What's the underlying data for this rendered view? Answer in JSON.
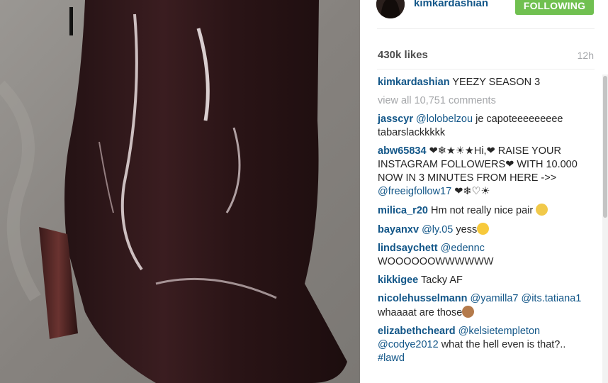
{
  "post": {
    "username": "kimkardashian",
    "follow_label": "FOLLOWING",
    "likes": "430k likes",
    "time": "12h"
  },
  "caption": {
    "user": "kimkardashian",
    "text": "YEEZY SEASON 3"
  },
  "view_all": "view all 10,751 comments",
  "comments": [
    {
      "user": "jasscyr",
      "mention": "@lolobelzou",
      "text": " je capoteeeeeeeee tabarslackkkkk"
    },
    {
      "user": "abw65834",
      "text": "❤❄★☀★Hi,❤ RAISE YOUR INSTAGRAM FOLLOWERS❤ WITH 10.000 NOW IN 3 MINUTES FROM HERE ->> ",
      "mention": "@freeigfollow17",
      "text2": " ❤❄♡☀"
    },
    {
      "user": "milica_r20",
      "text": "Hm not really nice pair "
    },
    {
      "user": "bayanxv",
      "mention": "@ly.05",
      "text": " yess"
    },
    {
      "user": "lindsaychett",
      "mention": "@edennc",
      "text": " WOOOOOOWWWWWW"
    },
    {
      "user": "kikkigee",
      "text": "Tacky AF"
    },
    {
      "user": "nicolehusselmann",
      "mention": "@yamilla7",
      "mention2": "@its.tatiana1",
      "text": " whaaaat are those"
    },
    {
      "user": "elizabethcheard",
      "mention": "@kelsietempleton",
      "mention2": "@codye2012",
      "text": " what the hell even is that?..",
      "hashtag": "#lawd"
    }
  ],
  "colors": {
    "username": "#125688",
    "follow_button": "#70c050",
    "muted": "#a5a7aa",
    "text": "#262626"
  },
  "icons": {
    "scream_emoji": "face-screaming-in-fear",
    "grin_emoji": "smiling-face-with-heart-eyes",
    "monkey_emoji": "see-no-evil-monkey"
  }
}
